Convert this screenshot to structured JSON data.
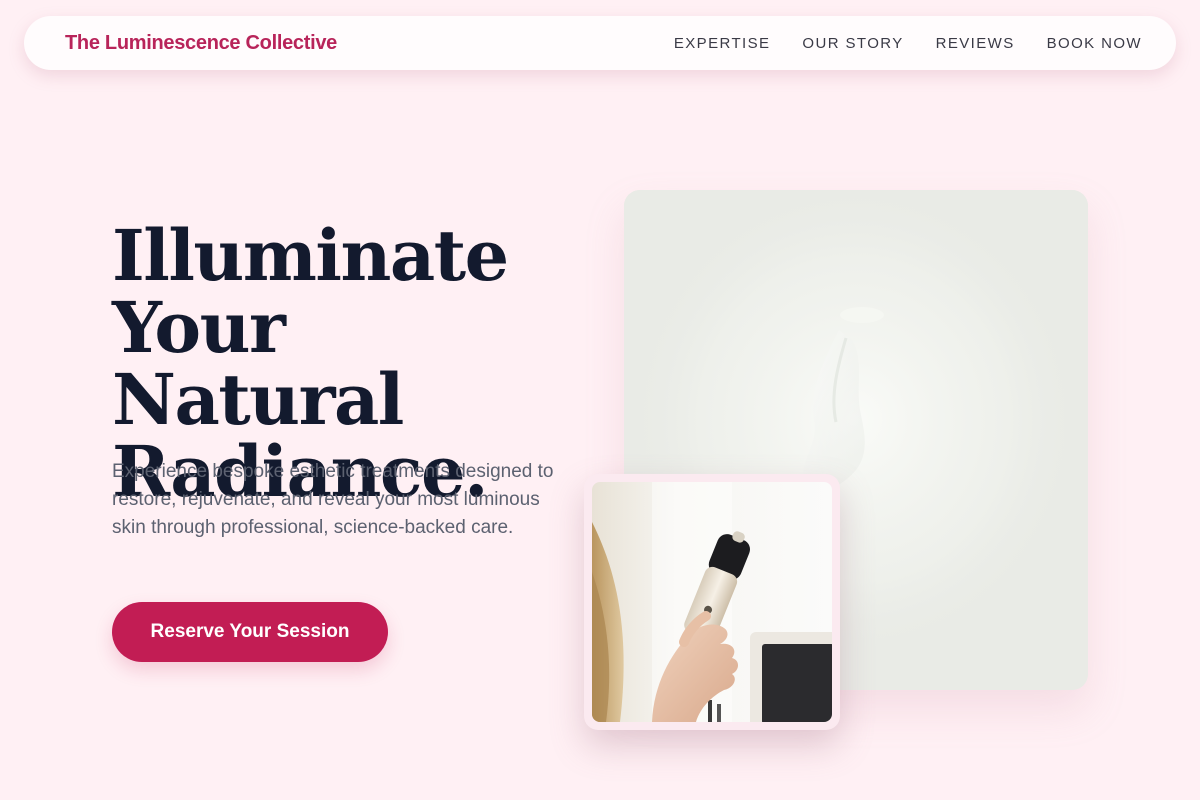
{
  "header": {
    "brand": "The Luminescence Collective",
    "nav": [
      {
        "label": "EXPERTISE"
      },
      {
        "label": "OUR STORY"
      },
      {
        "label": "REVIEWS"
      },
      {
        "label": "BOOK NOW"
      }
    ]
  },
  "hero": {
    "title_lines": [
      "Illuminate",
      "Your Natural",
      "Radiance."
    ],
    "description": "Experience bespoke esthetic treatments designed to restore, rejuvenate, and reveal your most luminous skin through professional, science-backed care.",
    "cta_label": "Reserve Your Session"
  },
  "colors": {
    "page_background": "#fff0f4",
    "brand_accent": "#b8245a",
    "cta_background": "#c21d54",
    "heading_text": "#131a2e",
    "body_text": "#5c6170"
  }
}
